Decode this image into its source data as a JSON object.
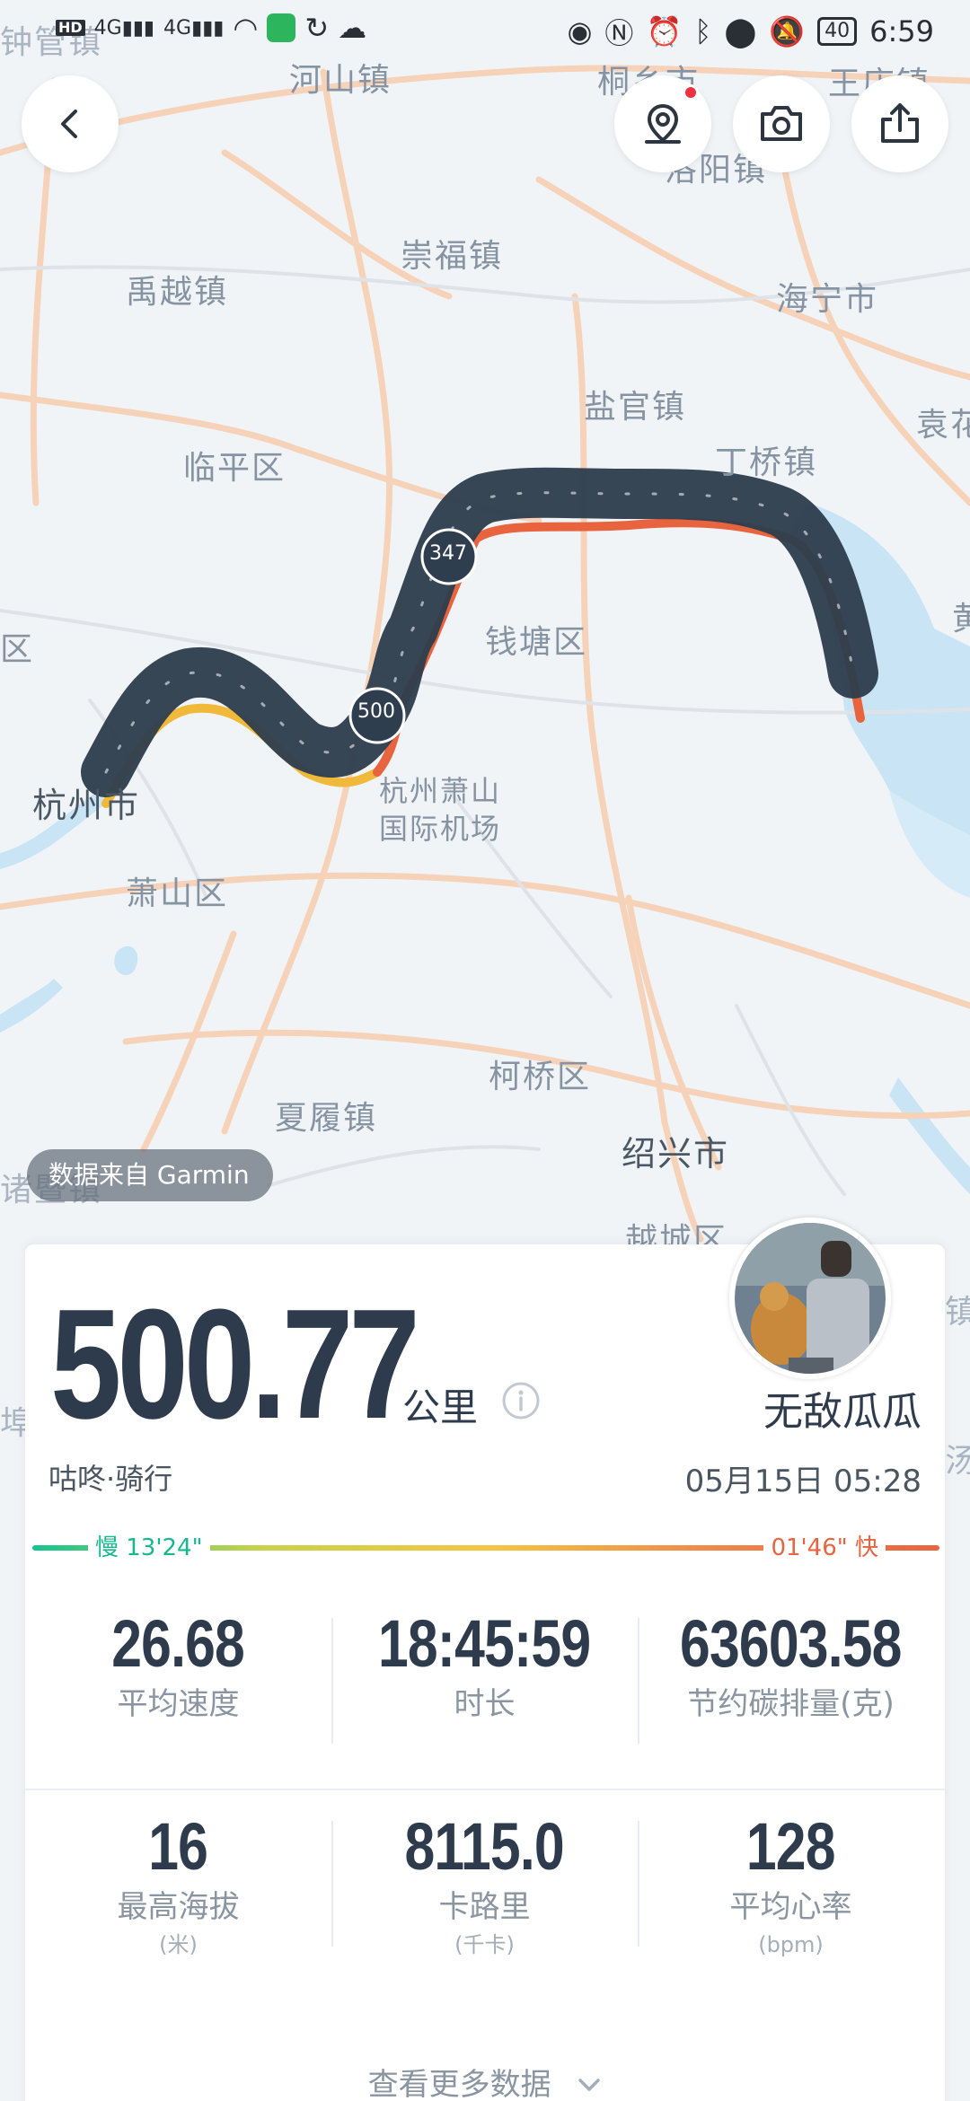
{
  "status_bar": {
    "network": [
      "HD",
      "4G",
      "4G"
    ],
    "time": "6:59",
    "battery": "40",
    "extra_icons": [
      "eye-icon",
      "nfc-icon",
      "alarm-icon",
      "bluetooth-icon",
      "location-icon",
      "mute-icon"
    ]
  },
  "map": {
    "labels": [
      "钟管镇",
      "河山镇",
      "桐乡市",
      "王店镇",
      "洛阳镇",
      "崇福镇",
      "禹越镇",
      "海宁市",
      "盐官镇",
      "袁花",
      "临平区",
      "丁桥镇",
      "黄",
      "区",
      "钱塘区",
      "杭州市",
      "杭州萧山",
      "国际机场",
      "萧山区",
      "柯桥区",
      "夏履镇",
      "绍兴市",
      "越城区",
      "诸暨镇",
      "埠",
      "汤",
      "镇"
    ],
    "route_markers": [
      "500",
      "347"
    ]
  },
  "buttons": {
    "back": "back-icon",
    "location": "location-pin-icon",
    "camera": "camera-icon",
    "share": "share-icon"
  },
  "source": "数据来自 Garmin",
  "summary": {
    "distance": "500.77",
    "unit": "公里",
    "username": "无敌瓜瓜",
    "activity": "咕咚·骑行",
    "datetime": "05月15日 05:28"
  },
  "pace": {
    "slow": "慢 13'24\"",
    "fast": "01'46\" 快",
    "colors": [
      "#17c48f",
      "#c7d24a",
      "#f4c542",
      "#f0884a",
      "#e8643f"
    ]
  },
  "stats_row1": [
    {
      "value": "26.68",
      "label": "平均速度"
    },
    {
      "value": "18:45:59",
      "label": "时长"
    },
    {
      "value": "63603.58",
      "label": "节约碳排量(克)"
    }
  ],
  "stats_row2": [
    {
      "value": "16",
      "label": "最高海拔",
      "unit": "(米)"
    },
    {
      "value": "8115.0",
      "label": "卡路里",
      "unit": "(千卡)"
    },
    {
      "value": "128",
      "label": "平均心率",
      "unit": "(bpm)"
    }
  ],
  "more": "查看更多数据"
}
